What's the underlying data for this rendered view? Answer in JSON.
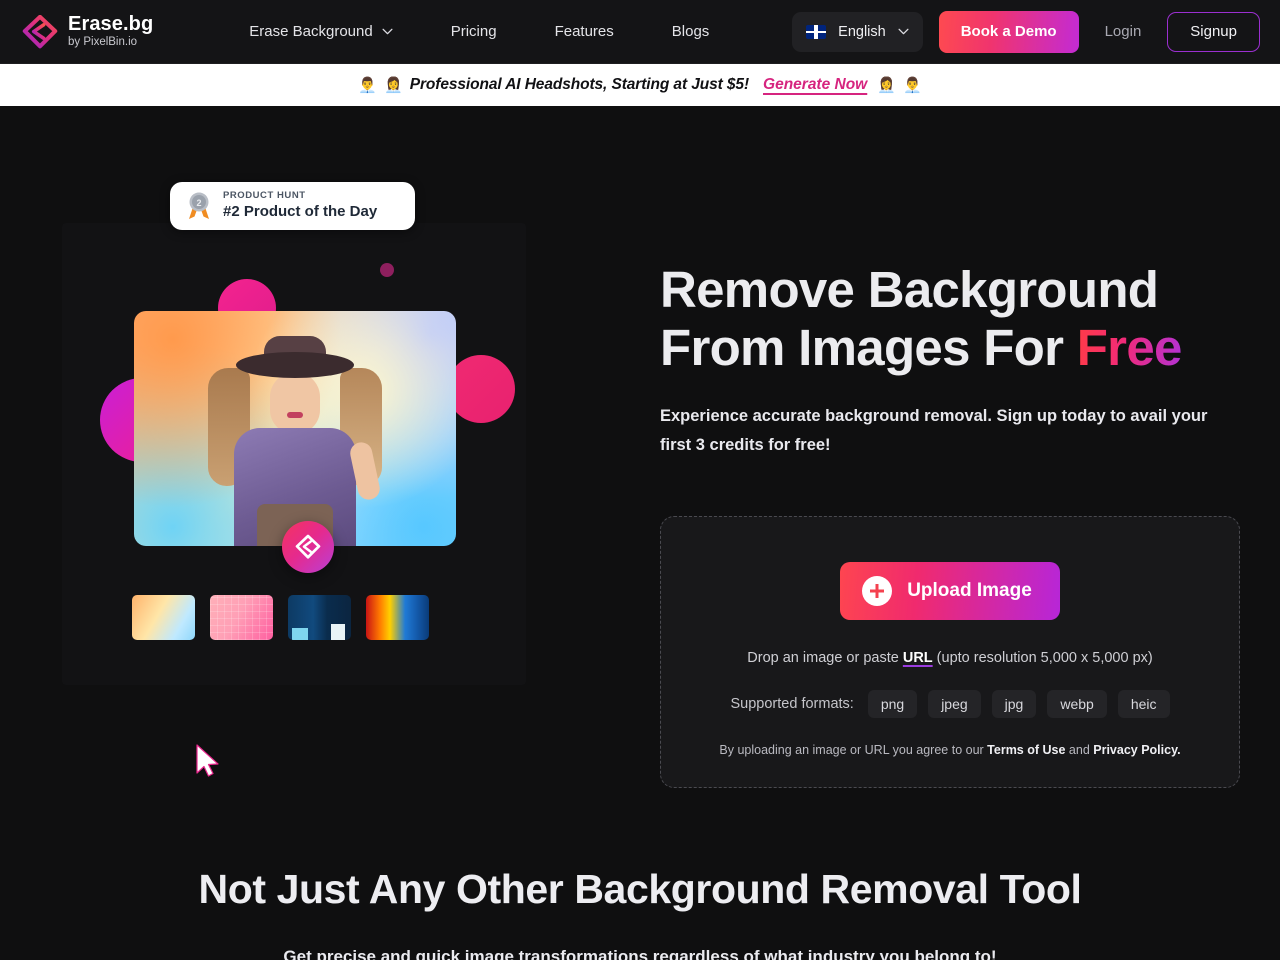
{
  "brand": {
    "title": "Erase.bg",
    "subtitle": "by PixelBin.io",
    "logo_icon": "erasebg-diamond-logo-icon"
  },
  "nav": {
    "links": [
      {
        "label": "Erase Background",
        "has_dropdown": true,
        "icon": "chevron-down-icon"
      },
      {
        "label": "Pricing",
        "has_dropdown": false
      },
      {
        "label": "Features",
        "has_dropdown": false
      },
      {
        "label": "Blogs",
        "has_dropdown": false
      }
    ],
    "language": {
      "label": "English",
      "flag_icon": "uk-flag-icon",
      "chevron_icon": "chevron-down-icon"
    },
    "book_demo": "Book a Demo",
    "login": "Login",
    "signup": "Signup"
  },
  "announcement": {
    "emoji_left_1": "👨‍💼",
    "emoji_left_2": "👩‍💼",
    "text": "Professional AI Headshots, Starting at Just $5!",
    "cta": "Generate Now",
    "emoji_right_1": "👩‍💼",
    "emoji_right_2": "👨‍💼"
  },
  "product_hunt": {
    "kicker": "PRODUCT HUNT",
    "title": "#2 Product of the Day",
    "medal_icon": "medal-2nd-place-icon"
  },
  "hero": {
    "heading_line1": "Remove Background",
    "heading_line2_plain": "From Images For ",
    "heading_line2_accent": "Free",
    "subheading": "Experience accurate background removal. Sign up today to avail your first 3 credits for free!",
    "logo_badge_icon": "erasebg-circle-logo-icon",
    "cursor_icon": "mouse-cursor-icon",
    "thumbnails": [
      {
        "name": "thumbnail-gradient-peach",
        "selected": true
      },
      {
        "name": "thumbnail-pink-grid",
        "selected": false
      },
      {
        "name": "thumbnail-blue-studio",
        "selected": false
      },
      {
        "name": "thumbnail-rainbow-stripes",
        "selected": false
      }
    ]
  },
  "upload": {
    "button_label": "Upload Image",
    "plus_icon": "plus-circle-icon",
    "drop_prefix": "Drop an image or paste ",
    "drop_link": "URL",
    "drop_suffix": " (upto resolution 5,000 x 5,000 px)",
    "formats_label": "Supported formats:",
    "formats": [
      "png",
      "jpeg",
      "jpg",
      "webp",
      "heic"
    ],
    "legal_prefix": "By uploading an image or URL you agree to our ",
    "legal_terms": "Terms of Use",
    "legal_and": " and ",
    "legal_privacy": "Privacy Policy."
  },
  "section2": {
    "title": "Not Just Any Other Background Removal Tool",
    "subtitle": "Get precise and quick image transformations regardless of what industry you belong to!"
  },
  "colors": {
    "page_bg": "#0f0f10",
    "nav_bg": "#141416",
    "accent_red": "#fe4a50",
    "accent_pink": "#f02a6e",
    "accent_purple": "#b726d8",
    "banner_cta": "#d6247f",
    "signup_border": "#9b2fd0"
  }
}
